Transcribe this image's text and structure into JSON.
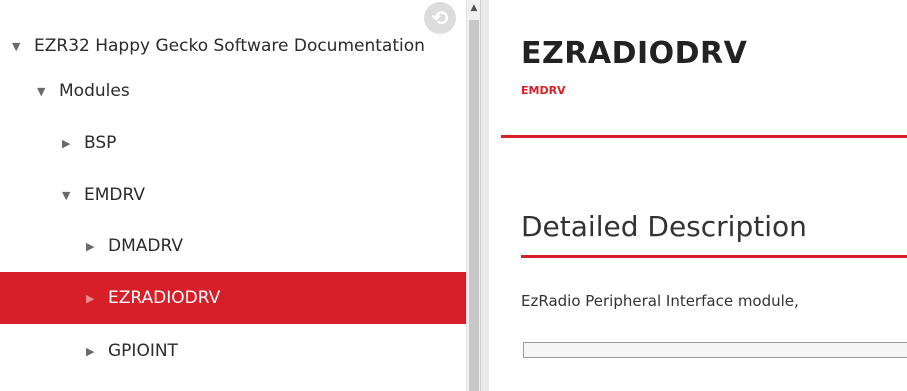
{
  "sidebar": {
    "items": [
      {
        "label": "EZR32 Happy Gecko Software Documentation",
        "arrow": "▼"
      },
      {
        "label": "Modules",
        "arrow": "▼"
      },
      {
        "label": "BSP",
        "arrow": "▶"
      },
      {
        "label": "EMDRV",
        "arrow": "▼"
      },
      {
        "label": "DMADRV",
        "arrow": "▶"
      },
      {
        "label": "EZRADIODRV",
        "arrow": "▶"
      },
      {
        "label": "GPIOINT",
        "arrow": "▶"
      }
    ],
    "sync_icon": "sync-icon"
  },
  "content": {
    "title": "EZRADIODRV",
    "module_link": "EMDRV",
    "section_heading": "Detailed Description",
    "description": "EzRadio Peripheral Interface module,"
  },
  "colors": {
    "accent": "#d71f2a",
    "selected_text": "#ffffff"
  }
}
